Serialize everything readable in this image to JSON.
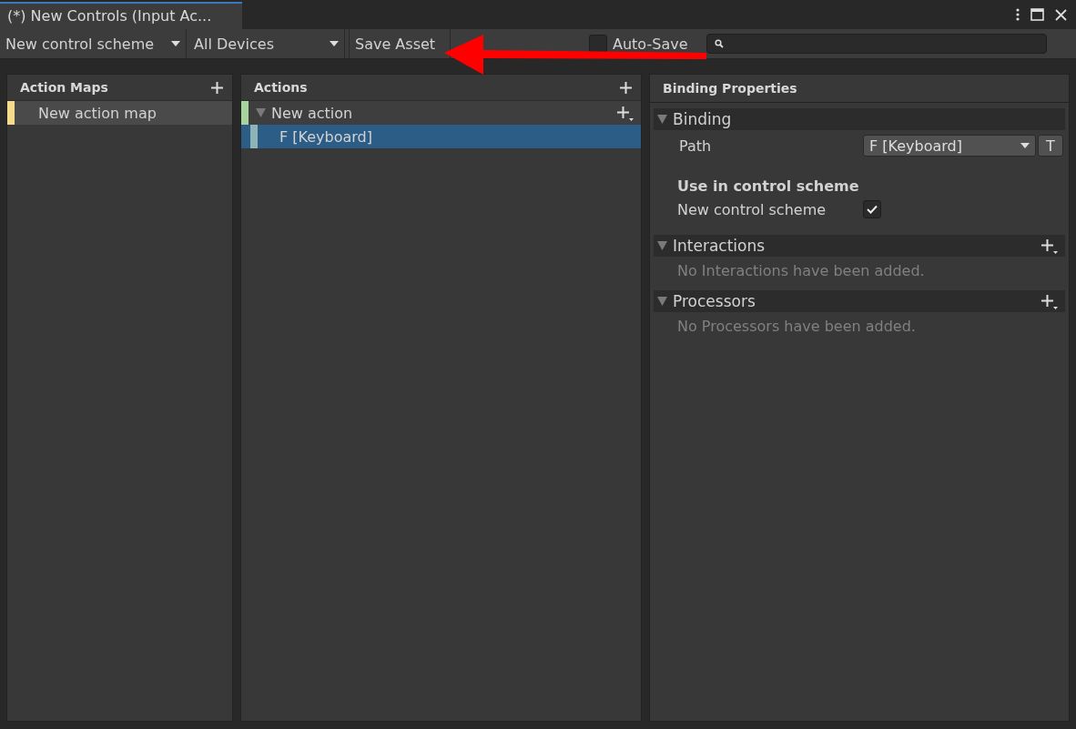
{
  "window": {
    "title": "(*) New Controls (Input Ac..."
  },
  "toolbar": {
    "control_scheme": "New control scheme",
    "devices": "All Devices",
    "save_button": "Save Asset",
    "auto_save": {
      "label": "Auto-Save",
      "checked": false
    }
  },
  "annotation": {
    "kind": "arrow",
    "color": "#ff0000"
  },
  "action_maps": {
    "title": "Action Maps",
    "items": [
      {
        "label": "New action map",
        "color": "#f5dc8c",
        "selected": true
      }
    ]
  },
  "actions": {
    "title": "Actions",
    "items": [
      {
        "label": "New action",
        "color": "#a6d49c",
        "expanded": true,
        "selected": false,
        "children": [
          {
            "label": "F [Keyboard]",
            "color": "#8fb4b8",
            "selected": true
          }
        ]
      }
    ]
  },
  "binding_properties": {
    "title": "Binding Properties",
    "binding": {
      "title": "Binding",
      "expanded": true,
      "path_label": "Path",
      "path_value": "F [Keyboard]",
      "t_button": "T",
      "scheme_heading": "Use in control scheme",
      "schemes": [
        {
          "label": "New control scheme",
          "checked": true
        }
      ]
    },
    "sections": [
      {
        "title": "Interactions",
        "expanded": true,
        "empty_text": "No Interactions have been added."
      },
      {
        "title": "Processors",
        "expanded": true,
        "empty_text": "No Processors have been added."
      }
    ]
  }
}
